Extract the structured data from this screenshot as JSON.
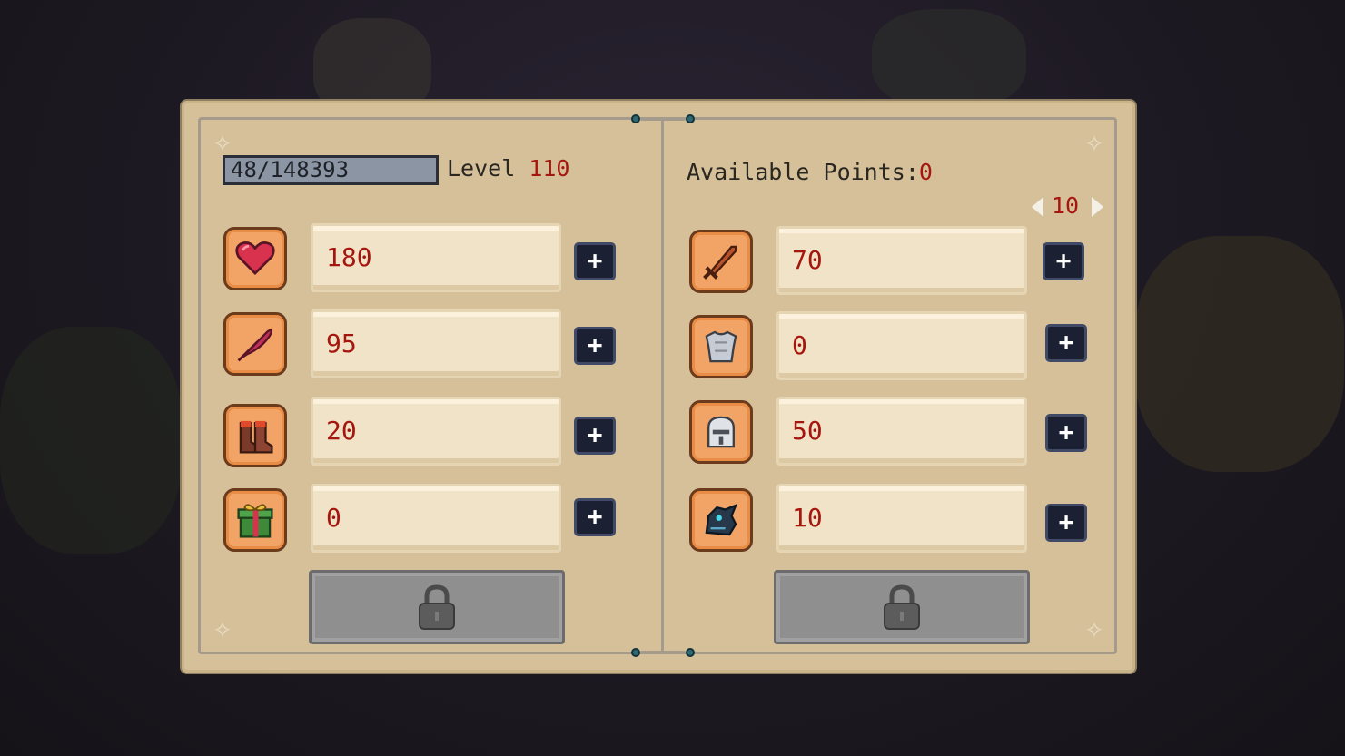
{
  "xp": {
    "text": "48/148393"
  },
  "level": {
    "label": "Level",
    "value": "110"
  },
  "points": {
    "label": "Available Points:",
    "value": "0"
  },
  "page_selector": {
    "value": "10"
  },
  "left_stats": [
    {
      "icon": "heart-icon",
      "value": "180"
    },
    {
      "icon": "feather-icon",
      "value": "95"
    },
    {
      "icon": "boots-icon",
      "value": "20"
    },
    {
      "icon": "gift-icon",
      "value": "0"
    }
  ],
  "right_stats": [
    {
      "icon": "sword-icon",
      "value": "70"
    },
    {
      "icon": "iron-chestplate-icon",
      "value": "0"
    },
    {
      "icon": "iron-helmet-icon",
      "value": "50"
    },
    {
      "icon": "dragon-head-icon",
      "value": "10"
    }
  ],
  "colors": {
    "panel": "#d5c09a",
    "value_text": "#a5160e",
    "plus_button": "#1b2033",
    "icon_frame": "#f2a466"
  }
}
